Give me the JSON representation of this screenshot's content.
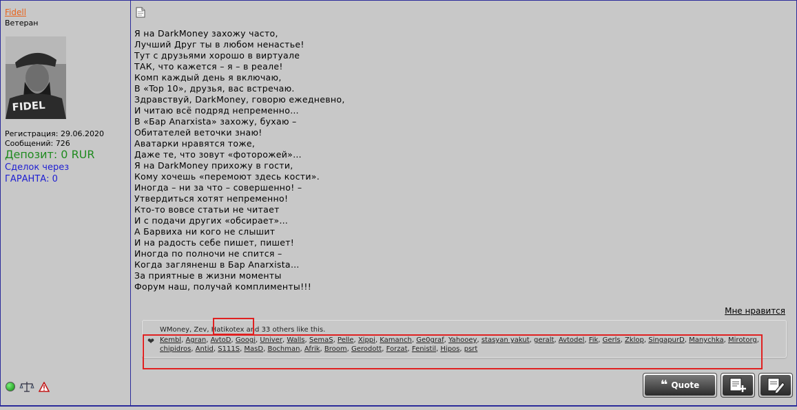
{
  "user": {
    "username": "Fidell",
    "title": "Ветеран",
    "avatar_caption": "FIDEL",
    "registration": "Регистрация: 29.06.2020",
    "messages": "Сообщений: 726",
    "deposit": "Депозит: 0 RUR",
    "deals_line1": "Сделок через",
    "deals_line2": "ГАРАНТА: 0"
  },
  "post": {
    "lines": [
      "Я на DarkMoney захожу часто,",
      "Лучший Друг ты в любом ненастье!",
      "Тут с друзьями хорошо в виртуале",
      "ТАК, что кажется – я – в реале!",
      "Комп каждый день я включаю,",
      "В «Top 10», друзья, вас встречаю.",
      "Здравствуй, DarkMoney, говорю ежедневно,",
      "И читаю всё подряд непременно…",
      "В «Бар Anarxista» захожу, бухаю –",
      "Обитателей веточки знаю!",
      "Аватарки нравятся тоже,",
      "Даже те, что зовут «фоторожей»…",
      "Я на DarkMoney прихожу в гости,",
      "Кому хочешь «перемоют здесь кости».",
      "Иногда – ни за что – совершенно! –",
      "Утвердиться хотят непременно!",
      "Кто-то вовсе статьи не читает",
      "И с подачи других «обсирает»…",
      "А Барвиха ни кого не слышит",
      "И на радость себе пишет, пишет!",
      "Иногда по полночи не спится –",
      "Когда загляненш в Бар Anarxista…",
      "За приятные в жизни моменты",
      "Форум наш, получай комплименты!!!"
    ],
    "like_label": "Мне нравится"
  },
  "likes": {
    "summary": "WMoney, Zev, Hatikotex and 33 others like this.",
    "users": [
      "Kembl",
      "Agran",
      "AvtoD",
      "Googi",
      "Univer",
      "Walls",
      "SemaS",
      "Pelle",
      "Xippi",
      "Kamanch",
      "Ge0graf",
      "Yahooey",
      "stasyan yakut",
      "geralt",
      "Avtodel",
      "Fik",
      "Gerls",
      "Zklop",
      "SingapurD",
      "Manychka",
      "Mirotorg",
      "chipidros",
      "Antid",
      "S111S",
      "MasD",
      "Bochman",
      "Afrik",
      "Broom",
      "Gerodott",
      "Forzat",
      "Fenistil",
      "Hipos",
      "psrt"
    ]
  },
  "buttons": {
    "quote_label": "Quote"
  },
  "icons": {
    "online": "online-status-icon",
    "scales": "reputation-scales-icon",
    "warning": "report-warning-icon",
    "post": "post-document-icon",
    "heart": "heart-icon",
    "multiquote": "multiquote-icon",
    "reply": "reply-edit-icon"
  },
  "colors": {
    "background": "#c8c8c8",
    "border": "#2a2a9a",
    "username": "#e8621a",
    "deposit": "#1f8a1f",
    "garant": "#1e1ed2",
    "highlight": "#e02020"
  }
}
